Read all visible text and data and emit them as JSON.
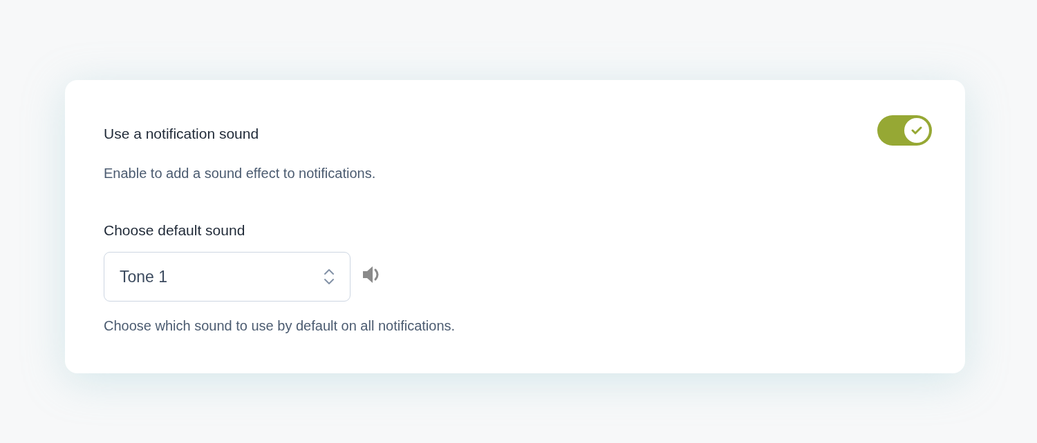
{
  "notification_sound": {
    "label": "Use a notification sound",
    "on": true,
    "description": "Enable to add a sound effect to notifications."
  },
  "default_sound": {
    "label": "Choose default sound",
    "value": "Tone 1",
    "description": "Choose which sound to use by default on all notifications."
  }
}
